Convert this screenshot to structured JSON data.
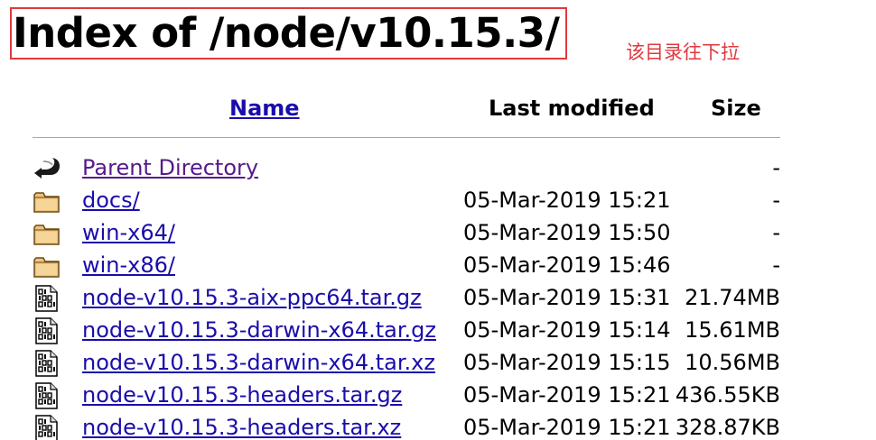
{
  "title": "Index of /node/v10.15.3/",
  "annotation": "该目录往下拉",
  "colors": {
    "annotation": "#e0393e",
    "link": "#1a0dab",
    "visited_link": "#551a8b"
  },
  "columns": {
    "name": "Name",
    "last_modified": "Last modified",
    "size": "Size"
  },
  "rows": [
    {
      "icon": "back-arrow-icon",
      "name": "Parent Directory",
      "date": "",
      "size": "-"
    },
    {
      "icon": "folder-icon",
      "name": "docs/",
      "date": "05-Mar-2019 15:21",
      "size": "-"
    },
    {
      "icon": "folder-icon",
      "name": "win-x64/",
      "date": "05-Mar-2019 15:50",
      "size": "-"
    },
    {
      "icon": "folder-icon",
      "name": "win-x86/",
      "date": "05-Mar-2019 15:46",
      "size": "-"
    },
    {
      "icon": "binary-file-icon",
      "name": "node-v10.15.3-aix-ppc64.tar.gz",
      "date": "05-Mar-2019 15:31",
      "size": "21.74MB"
    },
    {
      "icon": "binary-file-icon",
      "name": "node-v10.15.3-darwin-x64.tar.gz",
      "date": "05-Mar-2019 15:14",
      "size": "15.61MB"
    },
    {
      "icon": "binary-file-icon",
      "name": "node-v10.15.3-darwin-x64.tar.xz",
      "date": "05-Mar-2019 15:15",
      "size": "10.56MB"
    },
    {
      "icon": "binary-file-icon",
      "name": "node-v10.15.3-headers.tar.gz",
      "date": "05-Mar-2019 15:21",
      "size": "436.55KB"
    },
    {
      "icon": "binary-file-icon",
      "name": "node-v10.15.3-headers.tar.xz",
      "date": "05-Mar-2019 15:21",
      "size": "328.87KB"
    }
  ]
}
